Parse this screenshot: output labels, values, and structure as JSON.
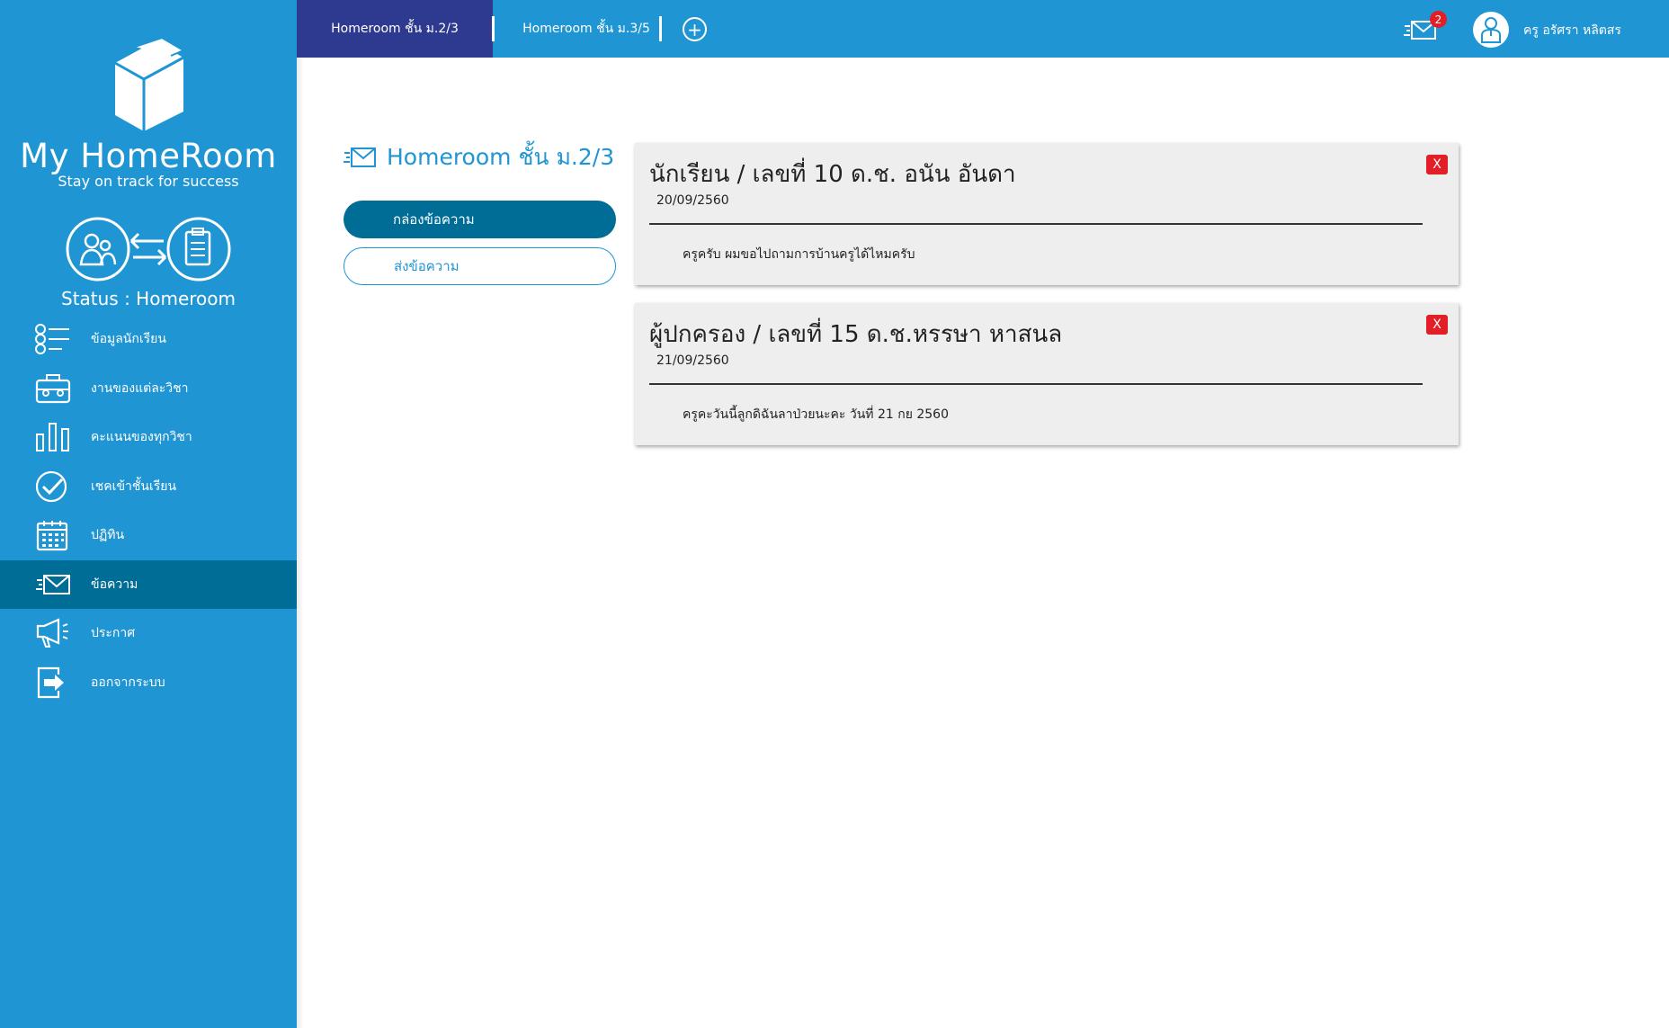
{
  "brand": {
    "title": "My HomeRoom",
    "subtitle": "Stay on track for success",
    "status": "Status : Homeroom"
  },
  "nav": [
    {
      "label": "ข้อมูลนักเรียน",
      "icon": "list-icon"
    },
    {
      "label": "งานของแต่ละวิชา",
      "icon": "briefcase-icon"
    },
    {
      "label": "คะแนนของทุกวิชา",
      "icon": "bar-chart-icon"
    },
    {
      "label": "เชคเข้าชั้นเรียน",
      "icon": "check-circle-icon"
    },
    {
      "label": "ปฏิทิน",
      "icon": "calendar-icon"
    },
    {
      "label": "ข้อความ",
      "icon": "mail-icon",
      "active": true
    },
    {
      "label": "ประกาศ",
      "icon": "megaphone-icon"
    },
    {
      "label": "ออกจากระบบ",
      "icon": "logout-icon"
    }
  ],
  "topbar": {
    "tabs": [
      {
        "label": "Homeroom ชั้น ม.2/3",
        "active": true
      },
      {
        "label": "Homeroom ชั้น ม.3/5",
        "active": false
      }
    ],
    "add_tab": "+",
    "mail_badge": "2",
    "user_name": "ครู อรัศรา หลิตสร"
  },
  "main": {
    "title": "Homeroom ชั้น ม.2/3",
    "inbox_button": "กล่องข้อความ",
    "send_button": "ส่งข้อความ",
    "messages": [
      {
        "title": "นักเรียน / เลขที่ 10 ด.ช. อนัน อันดา",
        "date": "20/09/2560",
        "body": "ครูครับ ผมขอไปถามการบ้านครูได้ไหมครับ",
        "close": "X"
      },
      {
        "title": "ผู้ปกครอง / เลขที่ 15 ด.ช.หรรษา หาสนล",
        "date": "21/09/2560",
        "body": "ครูคะวันนี้ลูกดิฉันลาป่วยนะคะ วันที่ 21 กย 2560",
        "close": "X"
      }
    ]
  },
  "colors": {
    "primary": "#1f95d3",
    "dark": "#006d96",
    "active_tab": "#2e3a8f",
    "danger": "#e21f26",
    "card": "#eeeeee"
  }
}
